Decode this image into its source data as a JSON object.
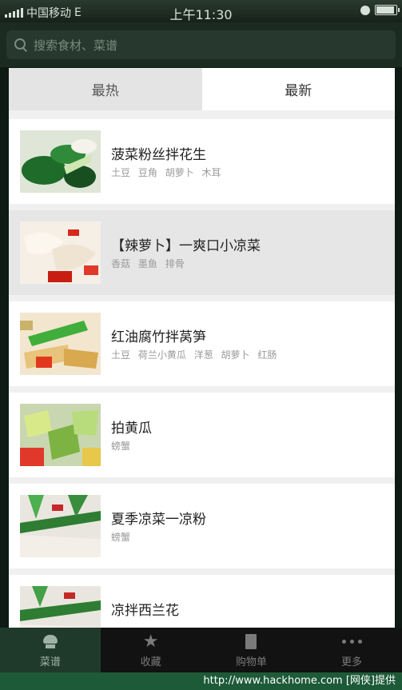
{
  "status": {
    "carrier": "中国移动",
    "network": "E",
    "time": "上午11:30"
  },
  "search": {
    "placeholder": "搜索食材、菜谱"
  },
  "tabs": [
    {
      "label": "最热"
    },
    {
      "label": "最新"
    }
  ],
  "recipes": [
    {
      "title": "菠菜粉丝拌花生",
      "tags": [
        "土豆",
        "豆角",
        "胡萝卜",
        "木耳"
      ]
    },
    {
      "title": "【辣萝卜】一爽口小凉菜",
      "tags": [
        "香菇",
        "墨鱼",
        "排骨"
      ]
    },
    {
      "title": "红油腐竹拌莴笋",
      "tags": [
        "土豆",
        "荷兰小黄瓜",
        "洋葱",
        "胡萝卜",
        "红肠"
      ]
    },
    {
      "title": "拍黄瓜",
      "tags": [
        "螃蟹"
      ]
    },
    {
      "title": "夏季凉菜一凉粉",
      "tags": [
        "螃蟹"
      ]
    },
    {
      "title": "凉拌西兰花",
      "tags": []
    }
  ],
  "tabbar": [
    {
      "label": "菜谱",
      "icon": "chef-hat-icon"
    },
    {
      "label": "收藏",
      "icon": "star-icon"
    },
    {
      "label": "购物单",
      "icon": "document-icon"
    },
    {
      "label": "更多",
      "icon": "more-dots-icon"
    }
  ],
  "footer": {
    "watermark": "http://www.hackhome.com [网侠]提供"
  }
}
